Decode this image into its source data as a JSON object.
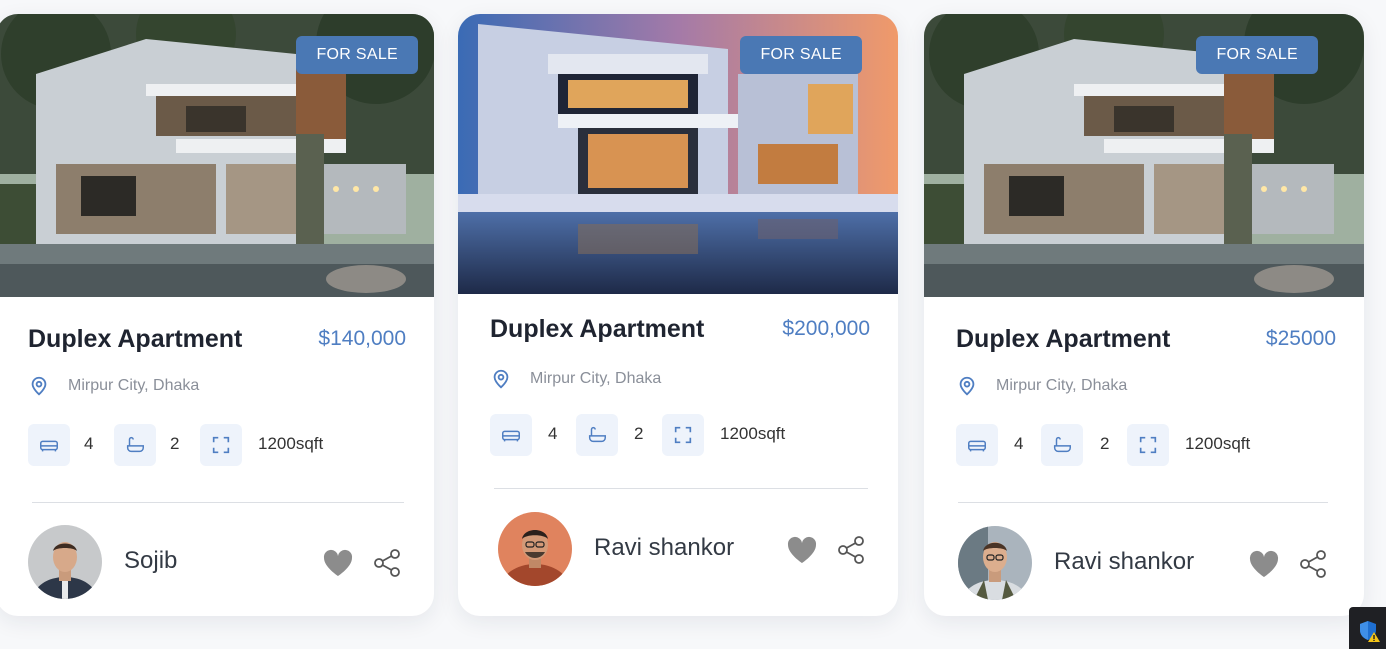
{
  "listings": [
    {
      "badge": "FOR SALE",
      "title": "Duplex Apartment",
      "price": "$140,000",
      "location": "Mirpur City, Dhaka",
      "beds": "4",
      "baths": "2",
      "area": "1200sqft",
      "agent": "Sojib",
      "photo": "modern-duplex-house-day",
      "icons": [
        "map-pin-icon",
        "bed-icon",
        "bathtub-icon",
        "expand-icon",
        "heart-icon",
        "share-icon"
      ]
    },
    {
      "badge": "FOR SALE",
      "title": "Duplex Apartment",
      "price": "$200,000",
      "location": "Mirpur City, Dhaka",
      "beds": "4",
      "baths": "2",
      "area": "1200sqft",
      "agent": "Ravi shankor",
      "photo": "modern-villa-with-pool-dusk",
      "icons": [
        "map-pin-icon",
        "bed-icon",
        "bathtub-icon",
        "expand-icon",
        "heart-icon",
        "share-icon"
      ]
    },
    {
      "badge": "FOR SALE",
      "title": "Duplex Apartment",
      "price": "$25000",
      "location": "Mirpur City, Dhaka",
      "beds": "4",
      "baths": "2",
      "area": "1200sqft",
      "agent": "Ravi shankor",
      "photo": "modern-duplex-house-day",
      "icons": [
        "map-pin-icon",
        "bed-icon",
        "bathtub-icon",
        "expand-icon",
        "heart-icon",
        "share-icon"
      ]
    }
  ],
  "colors": {
    "accent": "#4a78b4",
    "price": "#4f7ec2",
    "icon_bg": "#eef3fb",
    "heart": "#8c8c8c"
  },
  "system_tray": {
    "icon": "security-shield-warning-icon"
  }
}
